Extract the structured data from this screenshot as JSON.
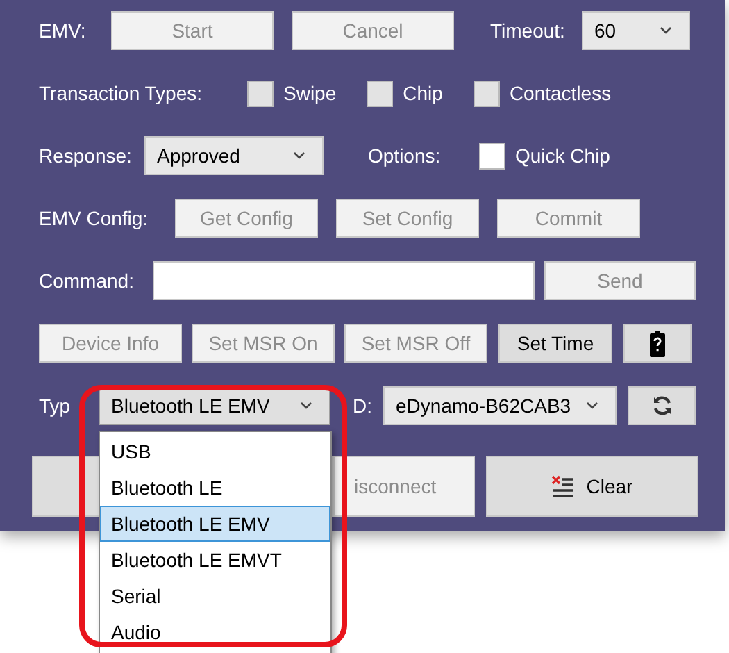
{
  "emv": {
    "label": "EMV:",
    "buttons": [
      {
        "label": "Start",
        "disabled": true
      },
      {
        "label": "Cancel",
        "disabled": true
      }
    ]
  },
  "timeout": {
    "label": "Timeout:",
    "value": "60"
  },
  "transaction_types": {
    "label": "Transaction Types:",
    "options": [
      {
        "label": "Swipe",
        "checked": false,
        "disabled": true
      },
      {
        "label": "Chip",
        "checked": false,
        "disabled": true
      },
      {
        "label": "Contactless",
        "checked": false,
        "disabled": true
      }
    ]
  },
  "response": {
    "label": "Response:",
    "value": "Approved"
  },
  "options": {
    "label": "Options:",
    "items": [
      {
        "label": "Quick Chip",
        "checked": false,
        "disabled": false
      }
    ]
  },
  "emv_config": {
    "label": "EMV Config:",
    "buttons": [
      {
        "label": "Get Config",
        "disabled": true
      },
      {
        "label": "Set Config",
        "disabled": true
      },
      {
        "label": "Commit",
        "disabled": true
      }
    ]
  },
  "command": {
    "label": "Command:",
    "send": {
      "label": "Send",
      "disabled": true
    }
  },
  "device_buttons": [
    {
      "kind": "text",
      "label": "Device Info",
      "disabled": true
    },
    {
      "kind": "text",
      "label": "Set MSR On",
      "disabled": true
    },
    {
      "kind": "text",
      "label": "Set MSR Off",
      "disabled": true
    },
    {
      "kind": "text",
      "label": "Set Time",
      "disabled": false
    },
    {
      "kind": "battery",
      "disabled": false
    }
  ],
  "connection": {
    "type_label": "Typ",
    "id_label": "D:",
    "id_value": "eDynamo-B62CAB3",
    "type_select": {
      "value": "Bluetooth LE EMV",
      "expanded": true,
      "options": [
        {
          "label": "USB",
          "selected": false
        },
        {
          "label": "Bluetooth LE",
          "selected": false
        },
        {
          "label": "Bluetooth LE EMV",
          "selected": true
        },
        {
          "label": "Bluetooth LE EMVT",
          "selected": false
        },
        {
          "label": "Serial",
          "selected": false
        },
        {
          "label": "Audio",
          "selected": false
        }
      ]
    }
  },
  "actions": [
    {
      "kind": "connect",
      "disabled": false
    },
    {
      "kind": "text",
      "label": "isconnect",
      "disabled": true
    },
    {
      "kind": "clear",
      "label": "Clear",
      "disabled": false
    }
  ]
}
